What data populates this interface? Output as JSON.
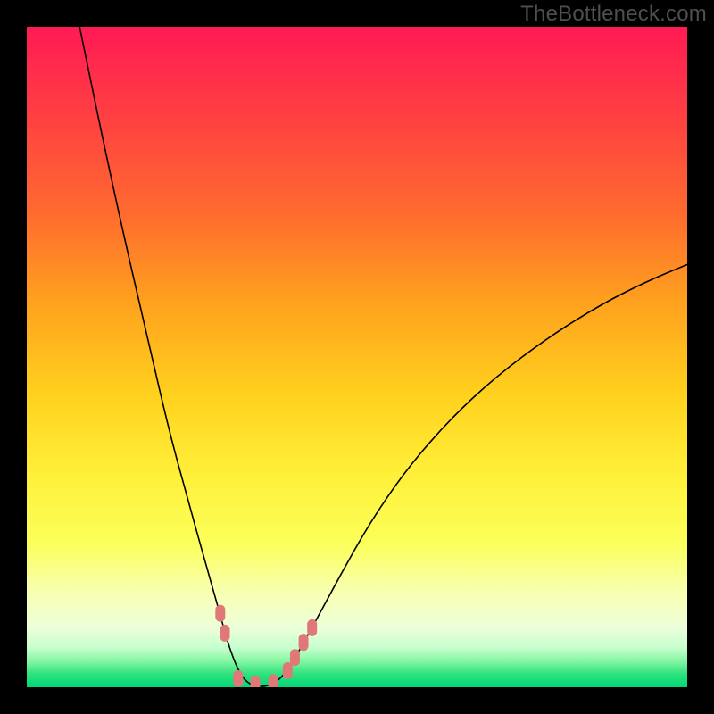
{
  "watermark_text": "TheBottleneck.com",
  "chart_data": {
    "type": "line",
    "title": "",
    "xlabel": "",
    "ylabel": "",
    "x_range": [
      0,
      1
    ],
    "y_range": [
      0,
      1
    ],
    "legend": null,
    "grid": false,
    "series": [
      {
        "name": "bottleneck-curve",
        "note": "V-shaped curve; minimum (green zone) around x≈0.33 where bottleneck≈0; rises toward 1.0 at x=0 and ~0.63 at x=1. Values are (x, normalized height 0=bottom/green, 1=top/red) estimated from pixels.",
        "points": [
          [
            0.08,
            1.0
          ],
          [
            0.115,
            0.83
          ],
          [
            0.15,
            0.67
          ],
          [
            0.185,
            0.52
          ],
          [
            0.215,
            0.39
          ],
          [
            0.245,
            0.28
          ],
          [
            0.27,
            0.19
          ],
          [
            0.29,
            0.12
          ],
          [
            0.305,
            0.065
          ],
          [
            0.32,
            0.025
          ],
          [
            0.335,
            0.005
          ],
          [
            0.355,
            0.0
          ],
          [
            0.375,
            0.005
          ],
          [
            0.395,
            0.025
          ],
          [
            0.415,
            0.06
          ],
          [
            0.44,
            0.105
          ],
          [
            0.475,
            0.17
          ],
          [
            0.52,
            0.25
          ],
          [
            0.575,
            0.33
          ],
          [
            0.64,
            0.405
          ],
          [
            0.71,
            0.47
          ],
          [
            0.79,
            0.53
          ],
          [
            0.87,
            0.58
          ],
          [
            0.94,
            0.615
          ],
          [
            1.0,
            0.64
          ]
        ]
      }
    ],
    "markers": {
      "name": "highlighted-segments",
      "color": "#e07878",
      "note": "Pink rounded markers near the valley on both branches; (x, normalized height) estimated from pixels.",
      "points": [
        [
          0.293,
          0.112
        ],
        [
          0.3,
          0.082
        ],
        [
          0.32,
          0.013
        ],
        [
          0.346,
          0.005
        ],
        [
          0.373,
          0.007
        ],
        [
          0.395,
          0.025
        ],
        [
          0.406,
          0.045
        ],
        [
          0.419,
          0.068
        ],
        [
          0.432,
          0.09
        ]
      ]
    }
  }
}
